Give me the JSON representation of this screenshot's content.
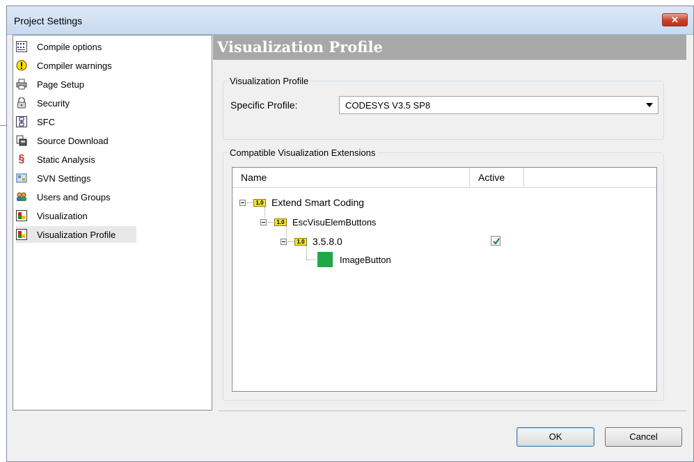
{
  "window": {
    "title": "Project Settings",
    "close_label": "✕"
  },
  "sidebar": {
    "items": [
      {
        "label": "Compile options",
        "icon": "compile-options-icon"
      },
      {
        "label": "Compiler warnings",
        "icon": "warning-icon"
      },
      {
        "label": "Page Setup",
        "icon": "printer-icon"
      },
      {
        "label": "Security",
        "icon": "lock-icon"
      },
      {
        "label": "SFC",
        "icon": "sfc-icon"
      },
      {
        "label": "Source Download",
        "icon": "source-download-icon"
      },
      {
        "label": "Static Analysis",
        "icon": "section-sign-icon"
      },
      {
        "label": "SVN Settings",
        "icon": "svn-icon"
      },
      {
        "label": "Users and Groups",
        "icon": "users-icon"
      },
      {
        "label": "Visualization",
        "icon": "visualization-icon"
      },
      {
        "label": "Visualization Profile",
        "icon": "visualization-icon",
        "selected": true
      }
    ]
  },
  "main": {
    "heading": "Visualization Profile",
    "profile_group": {
      "legend": "Visualization Profile",
      "label": "Specific Profile:",
      "value": "CODESYS V3.5 SP8"
    },
    "extensions_group": {
      "legend": "Compatible Visualization Extensions",
      "columns": [
        "Name",
        "Active"
      ],
      "tree": [
        {
          "label": "Extend Smart Coding",
          "badge": "1.0"
        },
        {
          "label": "EscVisuElemButtons",
          "badge": "1.0"
        },
        {
          "label": "3.5.8.0",
          "badge": "1.0",
          "active": true
        },
        {
          "label": "ImageButton"
        }
      ]
    }
  },
  "footer": {
    "ok_label": "OK",
    "cancel_label": "Cancel"
  },
  "colors": {
    "heading_bar": "#a8a8a8",
    "image_button_swatch": "#21a846"
  }
}
